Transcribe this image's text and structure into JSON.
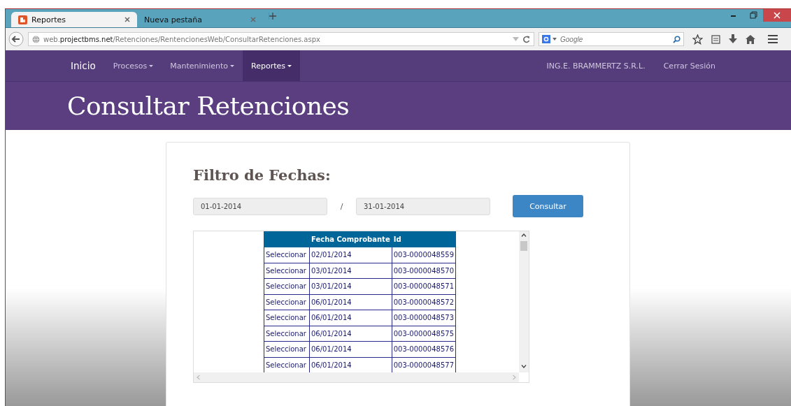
{
  "browser": {
    "tabs": [
      {
        "label": "Reportes",
        "selected": true
      },
      {
        "label": "Nueva pestaña",
        "selected": false
      }
    ],
    "address": "web.**projectbms.net**/Retenciones/RentencionesWeb/ConsultarRetenciones.aspx",
    "search": {
      "placeholder": "Google"
    }
  },
  "navbar": {
    "brand": "Inicio",
    "items": [
      {
        "label": "Procesos",
        "selected": false
      },
      {
        "label": "Mantenimiento",
        "selected": false
      },
      {
        "label": "Reportes",
        "selected": true
      }
    ],
    "right_items": [
      "ING.E. BRAMMERTZ S.R.L.",
      "Cerrar Sesión"
    ]
  },
  "page_title": "Consultar Retenciones",
  "filter": {
    "heading": "Filtro de Fechas:",
    "date_from": "01-01-2014",
    "separator": "/",
    "date_to": "31-01-2014",
    "button": "Consultar"
  },
  "table": {
    "columns": [
      "Fecha Comprobante",
      "Id"
    ],
    "rows": [
      {
        "action": "Seleccionar",
        "date": "02/01/2014",
        "id": "003-0000048559"
      },
      {
        "action": "Seleccionar",
        "date": "03/01/2014",
        "id": "003-0000048570"
      },
      {
        "action": "Seleccionar",
        "date": "03/01/2014",
        "id": "003-0000048571"
      },
      {
        "action": "Seleccionar",
        "date": "06/01/2014",
        "id": "003-0000048572"
      },
      {
        "action": "Seleccionar",
        "date": "06/01/2014",
        "id": "003-0000048573"
      },
      {
        "action": "Seleccionar",
        "date": "06/01/2014",
        "id": "003-0000048575"
      },
      {
        "action": "Seleccionar",
        "date": "06/01/2014",
        "id": "003-0000048576"
      },
      {
        "action": "Seleccionar",
        "date": "06/01/2014",
        "id": "003-0000048577"
      }
    ]
  }
}
